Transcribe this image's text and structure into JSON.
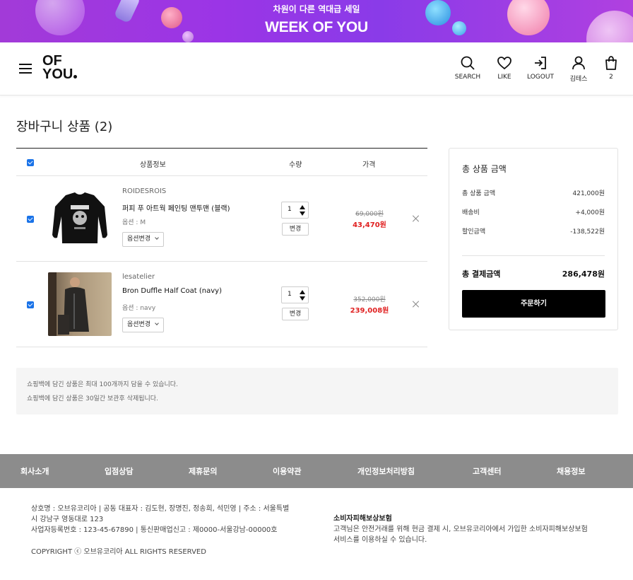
{
  "banner": {
    "subtitle": "차원이 다른 역대급 세일",
    "title": "WEEK OF YOU"
  },
  "header": {
    "logo_line1": "OF",
    "logo_line2": "YOU",
    "nav": [
      {
        "label": "SEARCH",
        "icon": "search-icon"
      },
      {
        "label": "LIKE",
        "icon": "heart-icon"
      },
      {
        "label": "LOGOUT",
        "icon": "logout-icon"
      },
      {
        "label": "김테스",
        "icon": "user-icon"
      },
      {
        "label": "2",
        "icon": "bag-icon"
      }
    ]
  },
  "page": {
    "title": "장바구니 상품 (2)"
  },
  "cart": {
    "columns": {
      "info": "상품정보",
      "qty": "수량",
      "price": "가격"
    },
    "change_label": "변경",
    "option_change_label": "옵션변경",
    "items": [
      {
        "brand": "ROIDESROIS",
        "name": "퍼피 푸 아트웍 페인팅 맨투맨 (블랙)",
        "option": "옵션 : M",
        "qty": "1",
        "original_price": "69,000원",
        "sale_price": "43,470원",
        "checked": true
      },
      {
        "brand": "lesatelier",
        "name": "Bron Duffle Half Coat (navy)",
        "option": "옵션 : navy",
        "qty": "1",
        "original_price": "352,000원",
        "sale_price": "239,008원",
        "checked": true
      }
    ]
  },
  "summary": {
    "title": "총 상품 금액",
    "rows": [
      {
        "label": "총 상품 금액",
        "value": "421,000원"
      },
      {
        "label": "배송비",
        "value": "+4,000원"
      },
      {
        "label": "할인금액",
        "value": "-138,522원"
      }
    ],
    "total_label": "총 결제금액",
    "total_value": "286,478원",
    "order_button": "주문하기"
  },
  "notice": [
    "쇼핑백에 담긴 상품은 최대 100개까지 담을 수 있습니다.",
    "쇼핑백에 담긴 상품은 30일간 보관후 삭제됩니다."
  ],
  "footer": {
    "nav": [
      "회사소개",
      "입점상담",
      "제휴문의",
      "이용약관",
      "개인정보처리방침",
      "고객센터",
      "채용정보"
    ],
    "company_line1": "상호명 : 오브유코리아 | 공동 대표자 : 김도현, 장명진, 정송희, 석민영 | 주소 : 서울특별",
    "company_line2": "시 강남구 영동대로 123",
    "company_line3": "사업자등록번호 : 123-45-67890 | 통신판매업신고 : 제0000-서울강남-00000호",
    "copyright": "COPYRIGHT ⓒ 오브유코리아 ALL RIGHTS RESERVED",
    "insurance_title": "소비자피해보상보험",
    "insurance_line1": "고객님은 안전거래를 위해 현금 결제 시, 오브유코리아에서 가입한 소비자피해보상보험",
    "insurance_line2": "서비스를 이용하실 수 있습니다."
  }
}
